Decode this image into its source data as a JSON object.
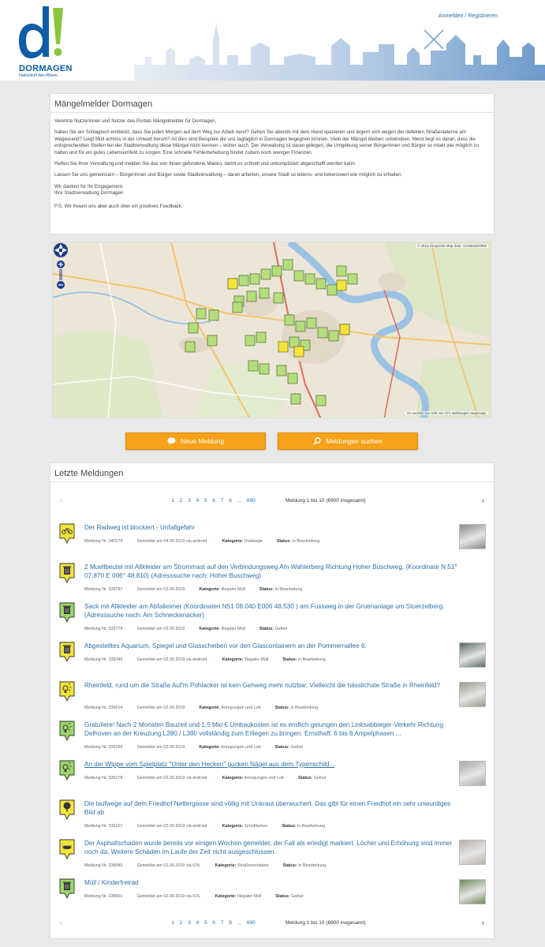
{
  "header": {
    "login_link": "Anmelden / Registrieren",
    "logo_text": "DORMAGEN",
    "logo_sub": "Natürlich! Am Rhein."
  },
  "intro": {
    "title": "Mängelmelder Dormagen",
    "paragraphs": [
      "Verehrte Nutzerinnen und Nutzer des Portals Mängelmelder für Dormagen,",
      "haben Sie ein Schlagloch entdeckt, dass Sie jeden Morgen auf dem Weg zur Arbeit nervt? Gehen Sie abends mit dem Hund spazieren und ärgern sich wegen der defekten Straßenlaterne am Wegesrand? Liegt Müll achtlos in der Umwelt herum? All dies sind Beispiele die uns tagtäglich in Dormagen begegnen können. Viele der Mängel bleiben unbehoben. Meist liegt es daran, dass die entsprechenden Stellen bei der Stadtverwaltung diese Mängel nicht kennen – woher auch. Der Verwaltung ist daran gelegen, die Umgebung seiner Bürgerinnen und Bürger so intakt wie möglich zu halten und für ein gutes Lebensumfeld zu sorgen. Eine schnelle Fehlerbehebung bindet zudem noch weniger Finanzen.",
      "Helfen Sie Ihrer Verwaltung und melden Sie das von Ihnen gefundene Manko, damit es schnell und unkompliziert abgeschafft werden kann.",
      "Lassen Sie uns gemeinsam – Bürgerinnen und Bürger sowie Stadtverwaltung – daran arbeiten, unsere Stadt so lebens- und liebenswert wie möglich zu erhalten.",
      "Wir danken für Ihr Engagement.",
      "Ihre Stadtverwaltung Dormagen",
      "P.S. Wir freuen uns aber auch über ein positives Feedback."
    ]
  },
  "map": {
    "attribution": "© 2016 Geoportal Map data: GeoBasisNRW",
    "count_note": "Es werden nur 100 von 371 Meldungen angezeigt."
  },
  "buttons": {
    "new_report": "Neue Meldung",
    "search_reports": "Meldungen suchen"
  },
  "reports": {
    "title": "Letzte Meldungen",
    "pager": {
      "pages": [
        "1",
        "2",
        "3",
        "4",
        "5",
        "6",
        "7",
        "8",
        "...",
        "690"
      ],
      "info": "Meldung 1 bis 10 (6900 insgesamt)",
      "prev": "‹",
      "next": "›"
    },
    "labels": {
      "category": "Kategorie:",
      "status": "Status:"
    },
    "items": [
      {
        "title": "Der Radweg ist blockiert - Unfallgefahr",
        "nr": "Meldung Nr. 340179",
        "date": "Gemeldet am 04.09.2019 via android.",
        "category": "Radwege",
        "status": "in Bearbeitung",
        "icon": "bicycle-icon",
        "pin_color": "#f2e43a"
      },
      {
        "title": "2 Muellbeutel mit Altkleider am Strommast auf den Verbindungsweg Am Wahlerberg Richtung Hoher Buschweg. (Koordinate N 51° 07.870 E 006° 48.810) (Adresssuche nach: Hoher Buschweg)",
        "nr": "Meldung Nr. 339797",
        "date": "Gemeldet am 03.09.2019",
        "category": "Illegaler Müll",
        "status": "in Bearbeitung",
        "icon": "trash-icon",
        "pin_color": "#f2e43a"
      },
      {
        "title": "Sack mit Altkleider am Abfalleimer (Koordinaten N51 08.040 E006 48.530 ) am Fussweg in der Gruenanlage um Stuerzelberg. (Adresssuche nach: Am Schneckenacker)",
        "nr": "Meldung Nr. 339778",
        "date": "Gemeldet am 03.09.2019",
        "category": "Illegaler Müll",
        "status": "Gelöst",
        "icon": "trash-icon",
        "pin_color": "#9bd66a"
      },
      {
        "title": "Abgestelltes Aquarium, Spiegel und Glasscheiben vor den Glascontainern an der Pommernallee 6.",
        "nr": "Meldung Nr. 339246",
        "date": "Gemeldet am 02.09.2019 via android.",
        "category": "Illegaler Müll",
        "status": "in Bearbeitung",
        "icon": "trash-icon",
        "pin_color": "#f2e43a"
      },
      {
        "title": "Rheinfeld, rund um die Straße Auf'm Pohlacker ist kein Gehweg mehr nutzbar. Vielleicht die hässlichste Straße in Rheinfeld?",
        "nr": "Meldung Nr. 339214",
        "date": "Gemeldet am 02.09.2019",
        "category": "Anregungen und Lob",
        "status": "in Bearbeitung",
        "icon": "idea-icon",
        "pin_color": "#f2e43a"
      },
      {
        "title": "Gratuliere! Nach 2 Monaten Bauzeit und 1,5 Mio € Umbaukosten ist es endlich gelungen den Linksabbieger-Verkehr Richtung Delhoven an der Kreuzung L280 / L380 vollständig zum Erliegen zu bringen. Ernsthaft: 6 bis 8 Ampelphasen ...",
        "nr": "Meldung Nr. 339196",
        "date": "Gemeldet am 02.09.2019",
        "category": "Anregungen und Lob",
        "status": "Gelöst",
        "icon": "idea-icon",
        "pin_color": "#9bd66a"
      },
      {
        "title": "An der Wippe vom Spielplatz \"Unter den Hecken\" gucken Nägel aus dem Typenschild...",
        "nr": "Meldung Nr. 339178",
        "date": "Gemeldet am 02.09.2019 via android.",
        "category": "Anregungen und Lob",
        "status": "Gelöst",
        "icon": "idea-icon",
        "pin_color": "#9bd66a"
      },
      {
        "title": "Die laufwege auf dem Friedhof Nettergasse sind völlig mit Unkraut überwuchert. Das gibt für einen Friedhof ein sehr unwurdiges Bild ab",
        "nr": "Meldung Nr. 339157",
        "date": "Gemeldet am 02.09.2019 via android.",
        "category": "Grünflächen",
        "status": "in Bearbeitung",
        "icon": "tree-icon",
        "pin_color": "#f2e43a"
      },
      {
        "title": "Der Asphaltschaden wurde bereits vor einigen Wochen gemeldet, der Fall als erledigt markiert. Löcher und Erhöhung sind immer noch da. Weitere Schäden im Laufe der Zeit nicht ausgeschlossen.",
        "nr": "Meldung Nr. 338940",
        "date": "Gemeldet am 02.09.2019 via iOS.",
        "category": "Straßenschäden",
        "status": "in Bearbeitung",
        "icon": "pothole-icon",
        "pin_color": "#f2e43a"
      },
      {
        "title": "Müll / Kinderfreirad",
        "nr": "Meldung Nr. 338901",
        "date": "Gemeldet am 02.09.2019 via iOS.",
        "category": "Illegaler Müll",
        "status": "Gelöst",
        "icon": "trash-icon",
        "pin_color": "#9bd66a"
      }
    ]
  },
  "colors": {
    "accent": "#f7a21a",
    "link": "#2f6fa7",
    "brand": "#0d5ea6",
    "pin_open": "#f2e43a",
    "pin_solved": "#9bd66a"
  }
}
